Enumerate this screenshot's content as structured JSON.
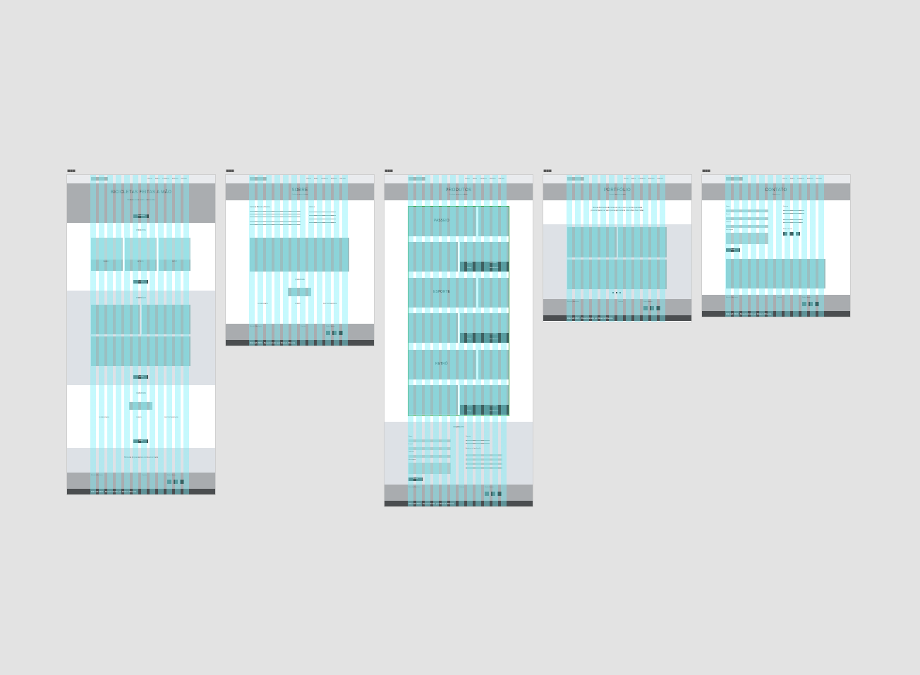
{
  "canvas": {
    "background": "#e3e3e3"
  },
  "colors": {
    "hero": "#aaadb0",
    "panel": "#dde1e6",
    "footer": "#a9acaf",
    "accent": "#3e5656",
    "grid": "#7df0fa",
    "selection": "#3aa34a"
  },
  "frame_handle": "▪▪▪",
  "nav": [
    "Home",
    "Sobre",
    "Produtos",
    "Portfólio",
    "Contato"
  ],
  "footer_bar": "Bikcraft 2024 - Desenvolvido por Bianca Oliveira",
  "pages": {
    "home": {
      "hero_title": "BICICLETAS FEITAS A MÃO",
      "hero_text": "Bicicletas feitas a mão e sob medida",
      "hero_button": "Orçamento",
      "produtos_title": "PRODUTOS",
      "produtos": [
        "PASSEIO",
        "ESPORTE",
        "RETRÔ"
      ],
      "produtos_button": "Produtos",
      "portfolio_title": "PORTFÓLIO",
      "portfolio_button": "Portfólio",
      "qualidade_title": "QUALIDADE",
      "qualidade_items": [
        "DURABILIDADE",
        "DESIGN",
        "SUSTENTABILIDADE"
      ],
      "qualidade_button": "Sobre",
      "quote": "Bicicletas projetadas para durar a vida inteira"
    },
    "sobre": {
      "title": "SOBRE",
      "subtitle": "Conheça a nossa história",
      "history_title": "Fabricas Bikcraft e História",
      "valores_title": "Valores",
      "qualidade_title": "QUALIDADE",
      "items": [
        "DURABILIDADE",
        "DESIGN",
        "SUSTENTABILIDADE"
      ]
    },
    "produtos": {
      "title": "PRODUTOS",
      "subtitle": "Conheça os nossos modelos",
      "sections": [
        "PASSEIO",
        "ESPORTE",
        "RETRÔ"
      ],
      "spec_labels": [
        "Sistema",
        "Velocidades",
        "Design",
        "Aerodinâmica"
      ],
      "orcamento_title": "ORÇAMENTO",
      "form_labels": [
        "Nome",
        "E-mail",
        "Telefone",
        "Mensagem"
      ],
      "form_button": "Enviar",
      "contact_title": "Contato",
      "address_title": "Endereço e Localização"
    },
    "portfolio": {
      "title": "PORTFÓLIO",
      "subtitle": "Nossos clientes e projetos",
      "quote": "Nossas bicicletas são feitas à mão e com a melhor qualidade possível para que você possa aproveitar a vida sobre duas rodas"
    },
    "contato": {
      "title": "CONTATO",
      "subtitle": "Fale conosco",
      "form_labels": [
        "Nome",
        "E-mail",
        "Telefone",
        "Mensagem"
      ],
      "form_button": "Enviar",
      "contact_title": "Contato",
      "social_title": "Redes Sociais"
    }
  },
  "footer_cols": {
    "about_title": "Bikcraft | Bicicletas",
    "contact_title": "Contato",
    "social_title": "Redes Sociais"
  }
}
